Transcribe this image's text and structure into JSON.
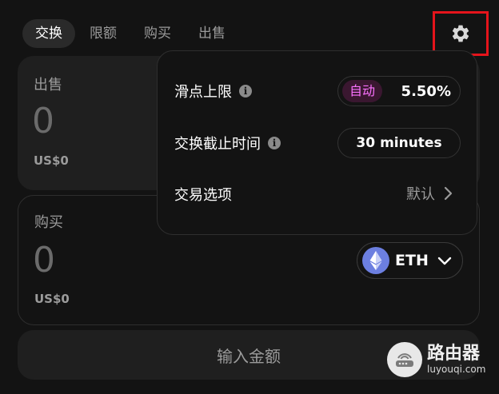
{
  "tabs": [
    {
      "label": "交换",
      "active": true
    },
    {
      "label": "限额",
      "active": false
    },
    {
      "label": "购买",
      "active": false
    },
    {
      "label": "出售",
      "active": false
    }
  ],
  "sell": {
    "label": "出售",
    "amount": "0",
    "usd": "US$0"
  },
  "buy": {
    "label": "购买",
    "amount": "0",
    "usd": "US$0",
    "token": "ETH"
  },
  "enter_amount_label": "输入金额",
  "settings": {
    "slippage": {
      "label": "滑点上限",
      "mode": "自动",
      "value": "5.50%"
    },
    "deadline": {
      "label": "交换截止时间",
      "value": "30",
      "unit": "minutes"
    },
    "trade_options": {
      "label": "交易选项",
      "value": "默认"
    }
  },
  "watermark": {
    "title": "路由器",
    "subtitle": "luyouqi.com"
  },
  "colors": {
    "accent_pink": "#fc72ff",
    "highlight_red": "#e5141b",
    "eth_blue": "#6c7fe0"
  }
}
